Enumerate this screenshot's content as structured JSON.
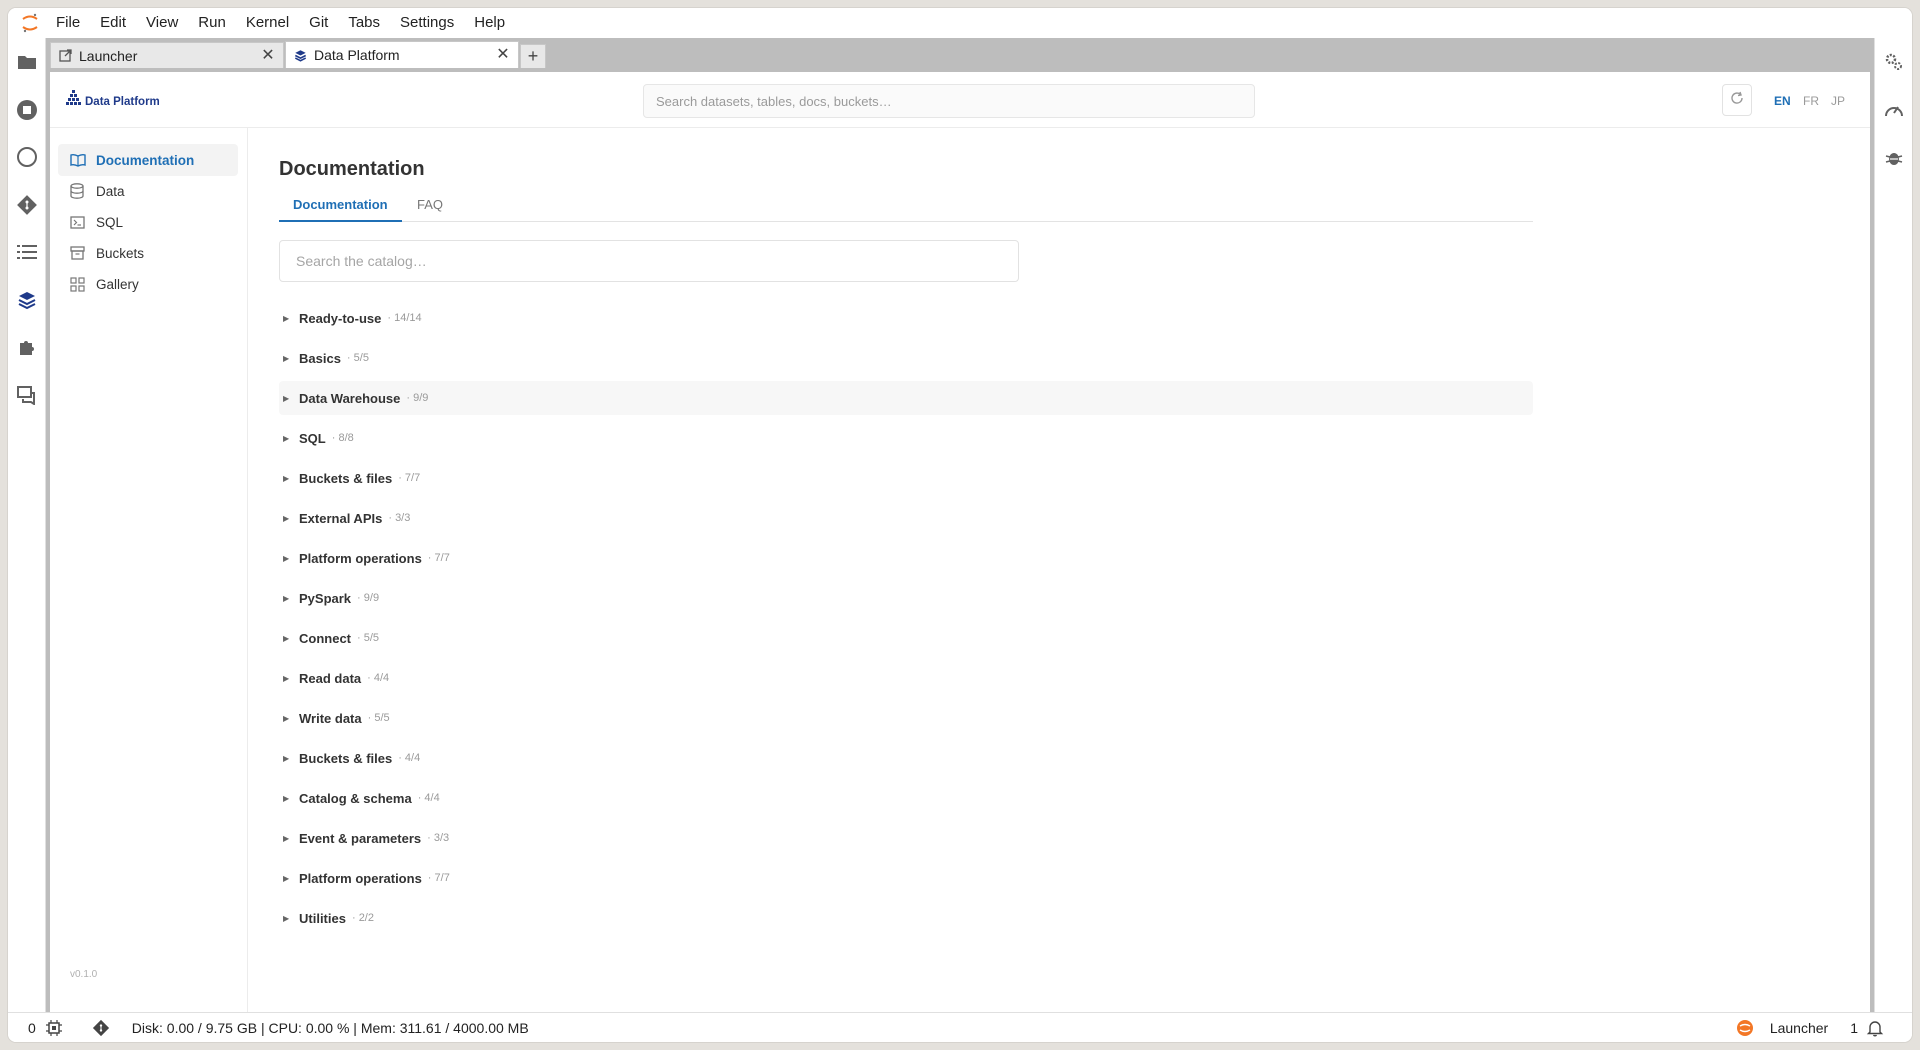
{
  "menubar": {
    "items": [
      "File",
      "Edit",
      "View",
      "Run",
      "Kernel",
      "Git",
      "Tabs",
      "Settings",
      "Help"
    ]
  },
  "left_bar": {
    "icons": [
      "folder-icon",
      "stop-circle-icon",
      "circle-icon",
      "git-icon",
      "toc-list-icon",
      "layers-icon",
      "puzzle-icon",
      "chat-icon"
    ]
  },
  "right_bar": {
    "icons": [
      "property-inspector-icon",
      "gauge-icon",
      "debugger-icon"
    ]
  },
  "tabs": [
    {
      "label": "Launcher",
      "icon": "launcher-icon"
    },
    {
      "label": "Data Platform",
      "icon": "layers-icon"
    }
  ],
  "app": {
    "brand": "Data Platform",
    "search_placeholder": "Search datasets, tables, docs, buckets…",
    "languages": [
      "EN",
      "FR",
      "JP"
    ],
    "active_language": "EN",
    "accent_color": "#1f6fb5"
  },
  "nav": {
    "items": [
      {
        "label": "Documentation",
        "icon": "book-icon"
      },
      {
        "label": "Data",
        "icon": "database-icon"
      },
      {
        "label": "SQL",
        "icon": "terminal-icon"
      },
      {
        "label": "Buckets",
        "icon": "archive-icon"
      },
      {
        "label": "Gallery",
        "icon": "gallery-icon"
      }
    ],
    "version": "v0.1.0"
  },
  "main": {
    "title": "Documentation",
    "tabs": [
      "Documentation",
      "FAQ"
    ],
    "search_placeholder": "Search the catalog…",
    "sections": [
      {
        "name": "Ready-to-use",
        "count": "· 14/14"
      },
      {
        "name": "Basics",
        "count": "· 5/5"
      },
      {
        "name": "Data Warehouse",
        "count": "· 9/9"
      },
      {
        "name": "SQL",
        "count": "· 8/8"
      },
      {
        "name": "Buckets & files",
        "count": "· 7/7"
      },
      {
        "name": "External APIs",
        "count": "· 3/3"
      },
      {
        "name": "Platform operations",
        "count": "· 7/7"
      },
      {
        "name": "PySpark",
        "count": "· 9/9"
      },
      {
        "name": "Connect",
        "count": "· 5/5"
      },
      {
        "name": "Read data",
        "count": "· 4/4"
      },
      {
        "name": "Write data",
        "count": "· 5/5"
      },
      {
        "name": "Buckets & files",
        "count": "· 4/4"
      },
      {
        "name": "Catalog & schema",
        "count": "· 4/4"
      },
      {
        "name": "Event & parameters",
        "count": "· 3/3"
      },
      {
        "name": "Platform operations",
        "count": "· 7/7"
      },
      {
        "name": "Utilities",
        "count": "· 2/2"
      }
    ]
  },
  "statusbar": {
    "kernel_count": "0",
    "resources": "Disk: 0.00 / 9.75 GB | CPU: 0.00 % | Mem: 311.61 / 4000.00 MB",
    "active_tab": "Launcher",
    "notifications": "1"
  }
}
